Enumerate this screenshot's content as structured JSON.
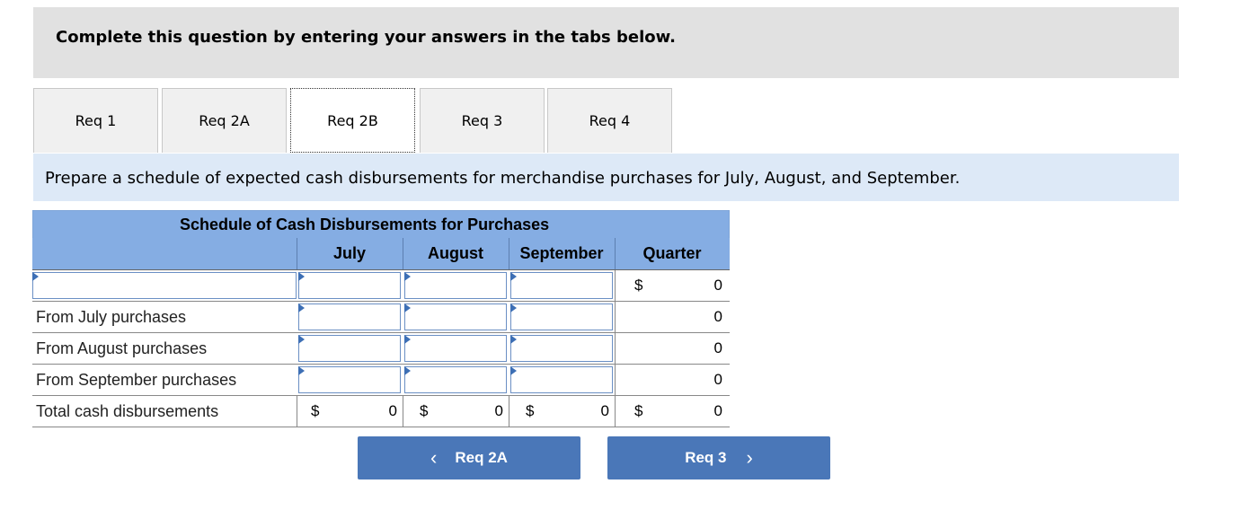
{
  "instructions": "Complete this question by entering your answers in the tabs below.",
  "tabs": [
    {
      "label": "Req 1",
      "active": false
    },
    {
      "label": "Req 2A",
      "active": false
    },
    {
      "label": "Req 2B",
      "active": true
    },
    {
      "label": "Req 3",
      "active": false
    },
    {
      "label": "Req 4",
      "active": false
    }
  ],
  "prompt": "Prepare a schedule of expected cash disbursements for merchandise purchases for July, August, and September.",
  "schedule": {
    "title": "Schedule of Cash Disbursements for Purchases",
    "columns": [
      "July",
      "August",
      "September",
      "Quarter"
    ],
    "rows": [
      {
        "label": "",
        "label_input": true,
        "inputs": [
          "",
          "",
          ""
        ],
        "quarter_symbol": "$",
        "quarter": "0"
      },
      {
        "label": "From July purchases",
        "inputs": [
          "",
          "",
          ""
        ],
        "quarter": "0"
      },
      {
        "label": "From August purchases",
        "inputs": [
          "",
          "",
          ""
        ],
        "quarter": "0"
      },
      {
        "label": "From September purchases",
        "inputs": [
          "",
          "",
          ""
        ],
        "quarter": "0"
      }
    ],
    "total": {
      "label": "Total cash disbursements",
      "currency_symbol": "$",
      "values": [
        "0",
        "0",
        "0",
        "0"
      ]
    }
  },
  "nav": {
    "prev_label": "Req 2A",
    "next_label": "Req 3",
    "prev_icon": "‹",
    "next_icon": "›"
  }
}
